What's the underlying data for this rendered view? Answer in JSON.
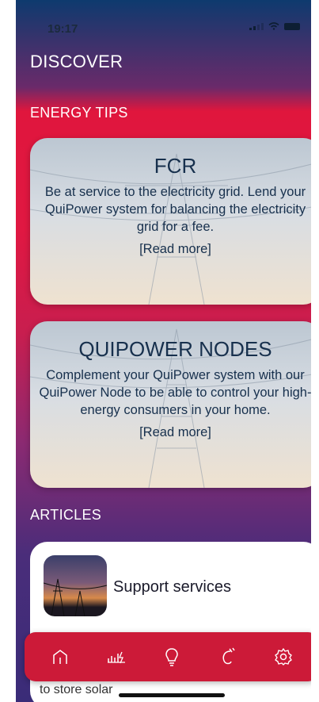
{
  "status_bar": {
    "time": "19:17"
  },
  "header": {
    "title": "DISCOVER"
  },
  "sections": {
    "tips_title": "ENERGY TIPS",
    "articles_title": "ARTICLES"
  },
  "tips": [
    {
      "title": "FCR",
      "body": "Be at service to the electricity grid. Lend your QuiPower system for balancing the electricity grid for a fee.",
      "link": "[Read more]"
    },
    {
      "title": "QUIPOWER NODES",
      "body": "Complement your QuiPower system with our QuiPower Node to be able to control your high-energy consumers in your home.",
      "link": "[Read more]"
    }
  ],
  "articles": [
    {
      "title": "Support services",
      "excerpt": "storage in their property. The battery can be used to store solar"
    }
  ],
  "tabbar": {
    "icons": [
      "home-icon",
      "energy-stats-icon",
      "lightbulb-icon",
      "plug-icon",
      "settings-icon"
    ],
    "color": "#cc1a38"
  },
  "colors": {
    "accent": "#e01842",
    "header": "#0e3a6e"
  }
}
